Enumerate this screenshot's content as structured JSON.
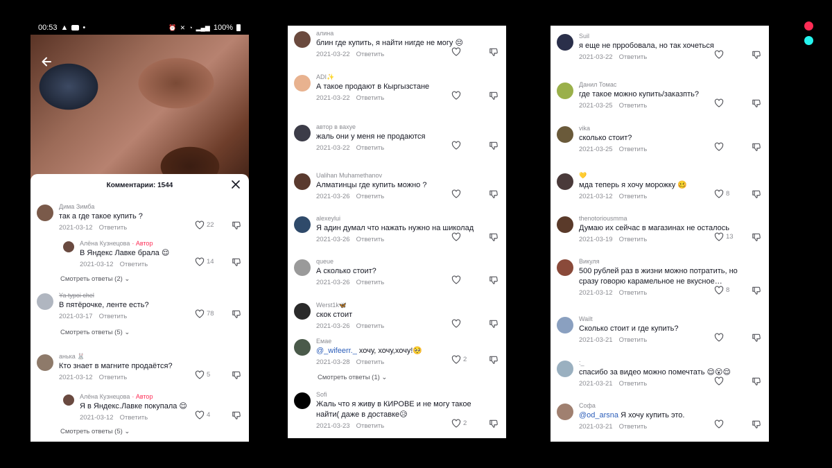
{
  "status_bar": {
    "time": "00:53",
    "battery": "100%"
  },
  "sheet": {
    "title": "Комментарии: 1544"
  },
  "panel1": {
    "comments": [
      {
        "user": "Дима Зимба",
        "text": "так а где такое купить ?",
        "date": "2021-03-12",
        "reply": "Ответить",
        "likes": "22",
        "avatar_color": "#7a5a4a"
      },
      {
        "user": "Алёна Кузнецова",
        "author_tag": "· Автор",
        "text": "В Яндекс Лавке брала 😌",
        "date": "2021-03-12",
        "reply": "Ответить",
        "likes": "14",
        "avatar_color": "#6a4a40"
      },
      {
        "view_replies": "Смотреть ответы (2) ⌄"
      },
      {
        "user": "Ya typoi chel",
        "text": "В пятёрочке, ленте есть?",
        "date": "2021-03-17",
        "reply": "Ответить",
        "likes": "78",
        "avatar_color": "#b0b6c0"
      },
      {
        "view_replies": "Смотреть ответы (5) ⌄"
      },
      {
        "user": "анька 🐰",
        "text": "Кто знает в магните продаётся?",
        "date": "2021-03-12",
        "reply": "Ответить",
        "likes": "5",
        "avatar_color": "#8e7a6a"
      },
      {
        "user": "Алёна Кузнецова",
        "author_tag": "· Автор",
        "text": "Я в Яндекс.Лавке покупала 😌",
        "date": "2021-03-12",
        "reply": "Ответить",
        "likes": "4",
        "avatar_color": "#6a4a40"
      },
      {
        "view_replies": "Смотреть ответы (5) ⌄"
      }
    ]
  },
  "panel2": {
    "comments": [
      {
        "user": "алина",
        "text": "блин где купить, я найти нигде не могу 😔",
        "date": "2021-03-22",
        "reply": "Ответить",
        "likes": "",
        "avatar_color": "#6b4a3e"
      },
      {
        "user": "ADI✨",
        "text": "А такое продают в Кыргызстане",
        "date": "2021-03-22",
        "reply": "Ответить",
        "likes": "",
        "avatar_color": "#e8b28f"
      },
      {
        "user": "автор в вахуе",
        "text": "жаль они у меня не продаются",
        "date": "2021-03-22",
        "reply": "Ответить",
        "likes": "",
        "avatar_color": "#3c3c48"
      },
      {
        "user": "Ualihan Muhamethanov",
        "text": "Алматинцы где купить можно ?",
        "date": "2021-03-26",
        "reply": "Ответить",
        "likes": "",
        "avatar_color": "#5a3a2e"
      },
      {
        "user": "alexeylui",
        "text": "Я адин думал что нажать нужно на шиколад",
        "date": "2021-03-26",
        "reply": "Ответить",
        "likes": "",
        "avatar_color": "#2f4a6a"
      },
      {
        "user": "queue",
        "text": "А сколько стоит?",
        "date": "2021-03-26",
        "reply": "Ответить",
        "likes": "",
        "avatar_color": "#9a9a9a"
      },
      {
        "user": "Werst1k🦋",
        "text": "скок стоит",
        "date": "2021-03-26",
        "reply": "Ответить",
        "likes": "",
        "avatar_color": "#2a2a2a"
      },
      {
        "user": "Емае",
        "mention": "@_wifeerr._",
        "text": " хочу, хочу,хочу!🥺",
        "date": "2021-03-28",
        "reply": "Ответить",
        "likes": "2",
        "avatar_color": "#4a5a4a"
      },
      {
        "view_replies": "Смотреть ответы (1) ⌄"
      },
      {
        "user": "Sofi",
        "text": "Жаль что я живу в КИРОВЕ и не могу такое найти( даже в доставке😥",
        "date": "2021-03-23",
        "reply": "Ответить",
        "likes": "2",
        "avatar_color": "#000000"
      }
    ]
  },
  "panel3": {
    "comments": [
      {
        "user": "Suil",
        "text": "я еще не прробовала, но так хочеться",
        "date": "2021-03-22",
        "reply": "Ответить",
        "likes": "",
        "avatar_color": "#2a2f4a"
      },
      {
        "user": "Данил Томас",
        "text": "где такое можно купить/заказпть?",
        "date": "2021-03-25",
        "reply": "Ответить",
        "likes": "",
        "avatar_color": "#9ab04a"
      },
      {
        "user": "vika",
        "text": "сколько стоит?",
        "date": "2021-03-25",
        "reply": "Ответить",
        "likes": "",
        "avatar_color": "#6a5a3a"
      },
      {
        "user": "💛",
        "text": "мда теперь я хочу морожку 🥴",
        "date": "2021-03-12",
        "reply": "Ответить",
        "likes": "8",
        "avatar_color": "#4a3a3a"
      },
      {
        "user": "thenotoriousmma",
        "text": "Думаю их сейчас в магазинах не осталось",
        "date": "2021-03-19",
        "reply": "Ответить",
        "likes": "13",
        "avatar_color": "#5a3a2a"
      },
      {
        "user": "Викуля",
        "text": "500 рублей раз в жизни можно потратить, но сразу говорю карамельное не вкусное…",
        "date": "2021-03-12",
        "reply": "Ответить",
        "likes": "8",
        "avatar_color": "#8a4a3a"
      },
      {
        "user": "Wailt",
        "text": "Сколько стоит и где купить?",
        "date": "2021-03-21",
        "reply": "Ответить",
        "likes": "",
        "avatar_color": "#8aa0c0"
      },
      {
        "user": ":_",
        "text": "спасибо за видео можно помечтать 😌😮😌",
        "date": "2021-03-21",
        "reply": "Ответить",
        "likes": "",
        "avatar_color": "#9ab0c0"
      },
      {
        "user": "Софа",
        "mention": "@od_arsna",
        "text": " Я хочу купить это.",
        "date": "2021-03-21",
        "reply": "Ответить",
        "likes": "",
        "avatar_color": "#a08070"
      }
    ]
  },
  "colors": {
    "accent": "#fe2c55",
    "logo_cyan": "#25f4ee",
    "logo_red": "#fe2c55",
    "mention": "#2b5db9",
    "muted_text": "#8a8b91"
  },
  "icons": [
    "back-arrow-icon",
    "close-icon",
    "heart-icon",
    "dislike-icon",
    "chevron-down-icon"
  ]
}
